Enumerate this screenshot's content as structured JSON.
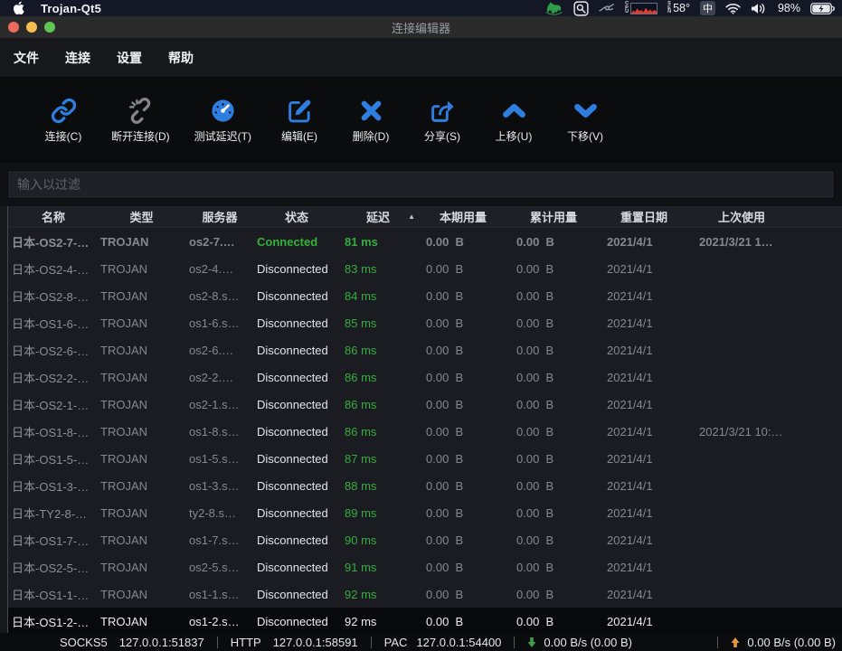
{
  "system_bar": {
    "app_name": "Trojan-Qt5",
    "cpu_widget_label": "CPU",
    "sensor_widget_label": "SEN",
    "temperature": "58°",
    "input_method": "中",
    "battery_percent": "98%"
  },
  "window": {
    "title": "连接编辑器"
  },
  "app_menu": {
    "items": [
      "文件",
      "连接",
      "设置",
      "帮助"
    ]
  },
  "toolbar": {
    "items": [
      {
        "label": "连接(C)",
        "icon": "link-icon",
        "color": "#2e7ee0"
      },
      {
        "label": "断开连接(D)",
        "icon": "unlink-icon",
        "color": "#83878d"
      },
      {
        "label": "测试延迟(T)",
        "icon": "gauge-icon",
        "color": "#2e7ee0"
      },
      {
        "label": "编辑(E)",
        "icon": "edit-icon",
        "color": "#2e7ee0"
      },
      {
        "label": "删除(D)",
        "icon": "delete-icon",
        "color": "#2e7ee0"
      },
      {
        "label": "分享(S)",
        "icon": "share-icon",
        "color": "#2e7ee0"
      },
      {
        "label": "上移(U)",
        "icon": "chevron-up-icon",
        "color": "#2e7ee0"
      },
      {
        "label": "下移(V)",
        "icon": "chevron-down-icon",
        "color": "#2e7ee0"
      }
    ]
  },
  "filter": {
    "placeholder": "输入以过滤"
  },
  "table": {
    "columns": [
      {
        "key": "name",
        "label": "名称"
      },
      {
        "key": "type",
        "label": "类型"
      },
      {
        "key": "server",
        "label": "服务器"
      },
      {
        "key": "status",
        "label": "状态"
      },
      {
        "key": "latency",
        "label": "延迟",
        "sorted": "asc"
      },
      {
        "key": "current",
        "label": "本期用量"
      },
      {
        "key": "total",
        "label": "累计用量"
      },
      {
        "key": "reset",
        "label": "重置日期"
      },
      {
        "key": "last",
        "label": "上次使用"
      }
    ],
    "rows": [
      {
        "name": "日本-OS2-7-…",
        "type": "TROJAN",
        "server": "os2-7.…",
        "status": "Connected",
        "latency": "81 ms",
        "current": "0.00  B",
        "total": "0.00  B",
        "reset": "2021/4/1",
        "last": "2021/3/21 1…",
        "connected": true,
        "selected": false
      },
      {
        "name": "日本-OS2-4-…",
        "type": "TROJAN",
        "server": "os2-4.…",
        "status": "Disconnected",
        "latency": "83 ms",
        "current": "0.00  B",
        "total": "0.00  B",
        "reset": "2021/4/1",
        "last": "",
        "connected": false,
        "selected": false
      },
      {
        "name": "日本-OS2-8-…",
        "type": "TROJAN",
        "server": "os2-8.s…",
        "status": "Disconnected",
        "latency": "84 ms",
        "current": "0.00  B",
        "total": "0.00  B",
        "reset": "2021/4/1",
        "last": "",
        "connected": false,
        "selected": false
      },
      {
        "name": "日本-OS1-6-…",
        "type": "TROJAN",
        "server": "os1-6.s…",
        "status": "Disconnected",
        "latency": "85 ms",
        "current": "0.00  B",
        "total": "0.00  B",
        "reset": "2021/4/1",
        "last": "",
        "connected": false,
        "selected": false
      },
      {
        "name": "日本-OS2-6-…",
        "type": "TROJAN",
        "server": "os2-6.…",
        "status": "Disconnected",
        "latency": "86 ms",
        "current": "0.00  B",
        "total": "0.00  B",
        "reset": "2021/4/1",
        "last": "",
        "connected": false,
        "selected": false
      },
      {
        "name": "日本-OS2-2-…",
        "type": "TROJAN",
        "server": "os2-2.…",
        "status": "Disconnected",
        "latency": "86 ms",
        "current": "0.00  B",
        "total": "0.00  B",
        "reset": "2021/4/1",
        "last": "",
        "connected": false,
        "selected": false
      },
      {
        "name": "日本-OS2-1-…",
        "type": "TROJAN",
        "server": "os2-1.s…",
        "status": "Disconnected",
        "latency": "86 ms",
        "current": "0.00  B",
        "total": "0.00  B",
        "reset": "2021/4/1",
        "last": "",
        "connected": false,
        "selected": false
      },
      {
        "name": "日本-OS1-8-…",
        "type": "TROJAN",
        "server": "os1-8.s…",
        "status": "Disconnected",
        "latency": "86 ms",
        "current": "0.00  B",
        "total": "0.00  B",
        "reset": "2021/4/1",
        "last": "2021/3/21 10:…",
        "connected": false,
        "selected": false
      },
      {
        "name": "日本-OS1-5-…",
        "type": "TROJAN",
        "server": "os1-5.s…",
        "status": "Disconnected",
        "latency": "87 ms",
        "current": "0.00  B",
        "total": "0.00  B",
        "reset": "2021/4/1",
        "last": "",
        "connected": false,
        "selected": false
      },
      {
        "name": "日本-OS1-3-…",
        "type": "TROJAN",
        "server": "os1-3.s…",
        "status": "Disconnected",
        "latency": "88 ms",
        "current": "0.00  B",
        "total": "0.00  B",
        "reset": "2021/4/1",
        "last": "",
        "connected": false,
        "selected": false
      },
      {
        "name": "日本-TY2-8-…",
        "type": "TROJAN",
        "server": "ty2-8.s…",
        "status": "Disconnected",
        "latency": "89 ms",
        "current": "0.00  B",
        "total": "0.00  B",
        "reset": "2021/4/1",
        "last": "",
        "connected": false,
        "selected": false
      },
      {
        "name": "日本-OS1-7-…",
        "type": "TROJAN",
        "server": "os1-7.s…",
        "status": "Disconnected",
        "latency": "90 ms",
        "current": "0.00  B",
        "total": "0.00  B",
        "reset": "2021/4/1",
        "last": "",
        "connected": false,
        "selected": false
      },
      {
        "name": "日本-OS2-5-…",
        "type": "TROJAN",
        "server": "os2-5.s…",
        "status": "Disconnected",
        "latency": "91 ms",
        "current": "0.00  B",
        "total": "0.00  B",
        "reset": "2021/4/1",
        "last": "",
        "connected": false,
        "selected": false
      },
      {
        "name": "日本-OS1-1-…",
        "type": "TROJAN",
        "server": "os1-1.s…",
        "status": "Disconnected",
        "latency": "92 ms",
        "current": "0.00  B",
        "total": "0.00  B",
        "reset": "2021/4/1",
        "last": "",
        "connected": false,
        "selected": false
      },
      {
        "name": "日本-OS1-2-…",
        "type": "TROJAN",
        "server": "os1-2.s…",
        "status": "Disconnected",
        "latency": "92 ms",
        "current": "0.00  B",
        "total": "0.00  B",
        "reset": "2021/4/1",
        "last": "",
        "connected": false,
        "selected": true
      }
    ]
  },
  "status_bar": {
    "socks5_label": "SOCKS5",
    "socks5_value": "127.0.0.1:51837",
    "http_label": "HTTP",
    "http_value": "127.0.0.1:58591",
    "pac_label": "PAC",
    "pac_value": "127.0.0.1:54400",
    "download_value": "0.00 B/s (0.00 B)",
    "upload_value": "0.00 B/s (0.00 B)",
    "download_color": "#3d9e49",
    "upload_color": "#e8973a"
  }
}
